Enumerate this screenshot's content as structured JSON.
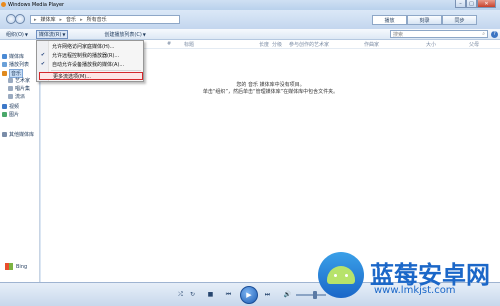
{
  "window": {
    "title": "Windows Media Player",
    "min": "–",
    "max": "□",
    "close": "✕"
  },
  "address": {
    "crumbs": [
      "媒体库",
      "音乐",
      "所有音乐"
    ],
    "sep": "▸"
  },
  "top_tabs": [
    "播放",
    "刻录",
    "同步"
  ],
  "toolbar": {
    "organize": "组织(O)",
    "stream": "媒体流(R)",
    "create_playlist": "创建播放列表(C)",
    "search_placeholder": "搜索",
    "help": "?"
  },
  "menu": {
    "items": [
      {
        "label": "允许网络访问家庭媒体(H)...",
        "checked": false
      },
      {
        "label": "允许远程控制我的播放器(R)...",
        "checked": true
      },
      {
        "label": "自动允许设备播放我的媒体(A)...",
        "checked": true
      },
      {
        "label": "更多流选项(M)...",
        "checked": false
      }
    ],
    "check_glyph": "✔"
  },
  "nav": {
    "items": [
      {
        "label": "媒体库",
        "color": "#4a8ad4"
      },
      {
        "label": "播放列表",
        "color": "#6aa0d8"
      },
      {
        "label": "音乐",
        "color": "#e08a1e"
      },
      {
        "label": "艺术家",
        "color": "#9aaac0"
      },
      {
        "label": "唱片集",
        "color": "#9aaac0"
      },
      {
        "label": "流派",
        "color": "#9aaac0"
      },
      {
        "label": "视频",
        "color": "#3c78c8"
      },
      {
        "label": "图片",
        "color": "#4aa86a"
      },
      {
        "label": "其他媒体库",
        "color": "#7a8ca8"
      }
    ],
    "bing": "Bing"
  },
  "columns": [
    "#",
    "标题",
    "长度",
    "分级",
    "参与创作的艺术家",
    "作曲家",
    "大小",
    "父母"
  ],
  "empty_message": {
    "line1": "您的 音乐 媒体库中没有项目。",
    "line2": "单击“组织”，然后单击“管理媒体库”在媒体库中包含文件夹。"
  },
  "player": {
    "shuffle": "⤮",
    "repeat": "↻",
    "stop": "■",
    "prev": "⏮",
    "play": "▶",
    "next": "⏭",
    "mute": "🔊"
  },
  "watermark": {
    "title": "蓝莓安卓网",
    "url": "www.lmkjst.com"
  }
}
